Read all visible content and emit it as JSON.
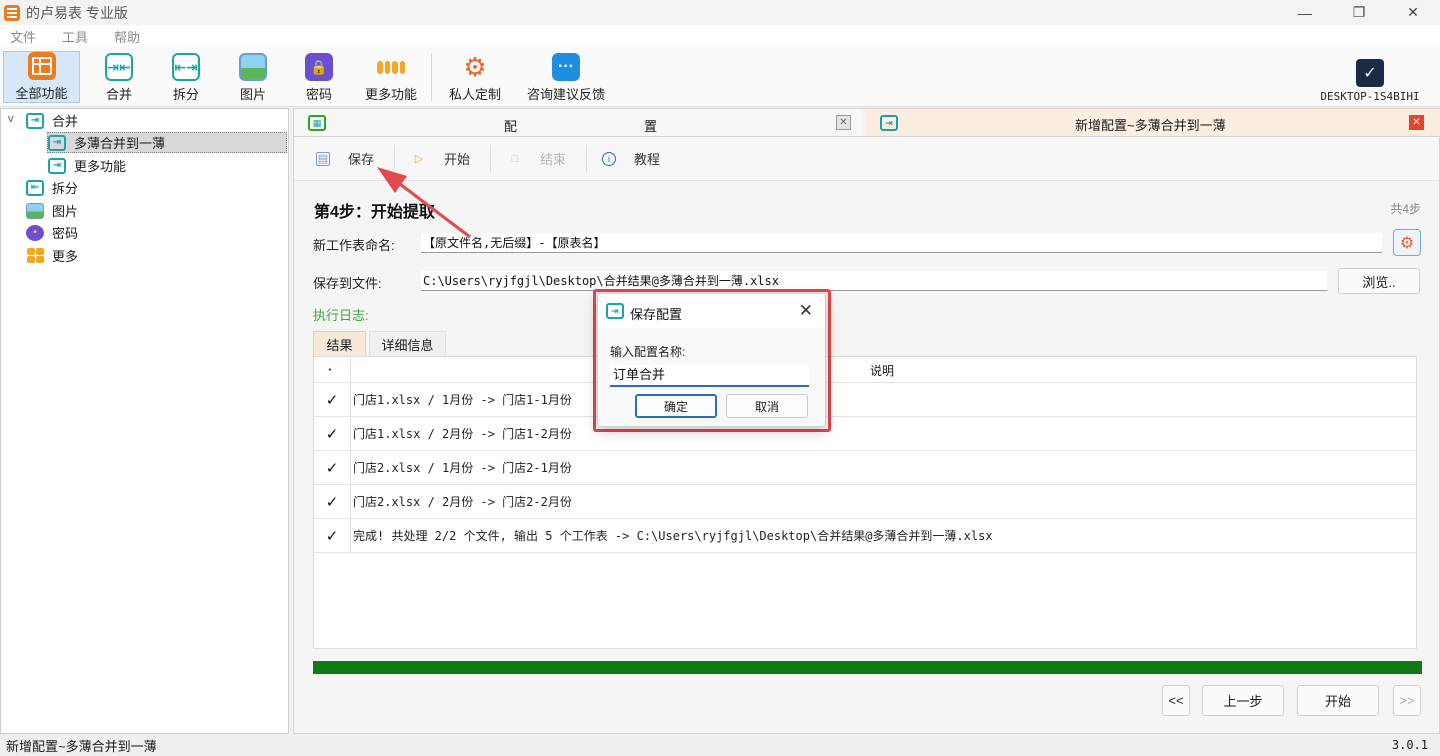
{
  "window": {
    "title": "的卢易表 专业版",
    "controls": {
      "minimize": "—",
      "maximize": "❐",
      "close": "✕"
    }
  },
  "menu": [
    "文件",
    "工具",
    "帮助"
  ],
  "toolbar": {
    "items": [
      {
        "label": "全部功能",
        "icon": "grid-icon",
        "active": true
      },
      {
        "label": "合并",
        "icon": "merge-icon"
      },
      {
        "label": "拆分",
        "icon": "split-icon"
      },
      {
        "label": "图片",
        "icon": "picture-icon"
      },
      {
        "label": "密码",
        "icon": "lock-icon"
      },
      {
        "label": "更多功能",
        "icon": "more-icon"
      },
      {
        "label": "私人定制",
        "icon": "custom-icon"
      },
      {
        "label": "咨询建议反馈",
        "icon": "chat-icon"
      }
    ],
    "computer_name": "DESKTOP-1S4BIHI"
  },
  "tree": {
    "items": [
      {
        "label": "合并",
        "icon": "merge-icon",
        "expanded": true
      },
      {
        "label": "多薄合并到一薄",
        "icon": "merge-icon",
        "selected": true
      },
      {
        "label": "更多功能",
        "icon": "merge-icon"
      },
      {
        "label": "拆分",
        "icon": "split-icon"
      },
      {
        "label": "图片",
        "icon": "picture-icon"
      },
      {
        "label": "密码",
        "icon": "lock-icon"
      },
      {
        "label": "更多",
        "icon": "more-icon"
      }
    ]
  },
  "tabs": {
    "config_left": "配",
    "config_right": "置",
    "active": "新增配置~多薄合并到一薄",
    "close": "✕"
  },
  "actions": {
    "save": "保存",
    "start": "开始",
    "stop": "结束",
    "tutorial": "教程"
  },
  "step": {
    "title": "第4步：开始提取",
    "count": "共4步"
  },
  "form": {
    "sheet_name_label": "新工作表命名:",
    "sheet_name_value": "【原文件名,无后缀】-【原表名】",
    "save_to_label": "保存到文件:",
    "save_to_value": "C:\\Users\\ryjfgjl\\Desktop\\合并结果@多薄合并到一薄.xlsx",
    "browse": "浏览..",
    "log_label": "执行日志:"
  },
  "log_tabs": [
    "结果",
    "详细信息"
  ],
  "log_table": {
    "col_status": "·",
    "col_desc": "说明",
    "rows": [
      {
        "status": "✓",
        "desc": "门店1.xlsx / 1月份 -> 门店1-1月份"
      },
      {
        "status": "✓",
        "desc": "门店1.xlsx / 2月份 -> 门店1-2月份"
      },
      {
        "status": "✓",
        "desc": "门店2.xlsx / 1月份 -> 门店2-1月份"
      },
      {
        "status": "✓",
        "desc": "门店2.xlsx / 2月份 -> 门店2-2月份"
      },
      {
        "status": "✓",
        "desc": "完成! 共处理 2/2 个文件, 输出 5 个工作表 -> C:\\Users\\ryjfgjl\\Desktop\\合并结果@多薄合并到一薄.xlsx"
      }
    ]
  },
  "progress": {
    "value": 1.0,
    "color": "#0f7a14"
  },
  "nav": {
    "first": "<<",
    "prev": "上一步",
    "next": "开始",
    "last": ">>"
  },
  "status": {
    "text": "新增配置~多薄合并到一薄",
    "version": "3.0.1"
  },
  "dialog": {
    "title": "保存配置",
    "close": "✕",
    "label": "输入配置名称:",
    "input_value": "订单合并",
    "ok": "确定",
    "cancel": "取消"
  },
  "colors": {
    "accent": "#1ba3a8",
    "highlight": "#e5484d",
    "progress": "#0f7a14"
  }
}
